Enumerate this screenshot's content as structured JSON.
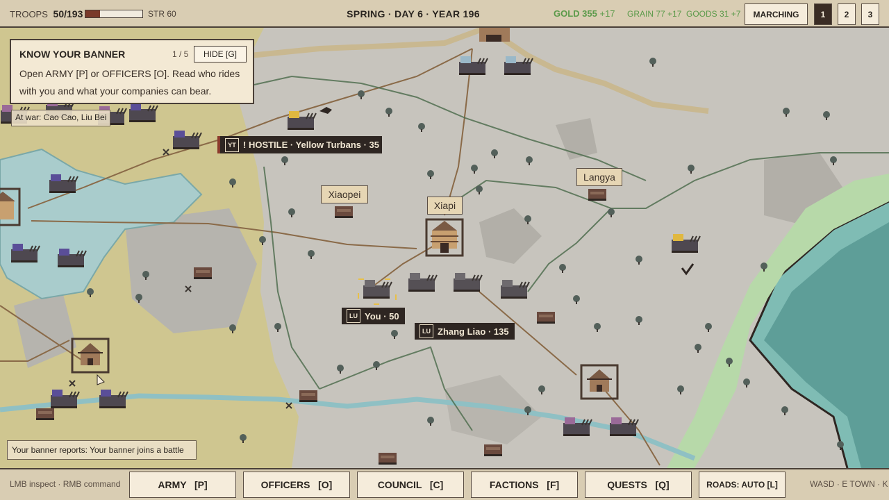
{
  "topbar": {
    "troops_label": "TROOPS",
    "troops_value": "50/193",
    "troops_fraction": 0.26,
    "strength": "STR 60",
    "date": "SPRING · DAY 6 · YEAR 196",
    "gold": "GOLD 355",
    "gold_delta": "+17",
    "grain": "GRAIN 77",
    "grain_delta": "+17",
    "goods": "GOODS 31",
    "goods_delta": "+7",
    "mode_button": "MARCHING",
    "speeds": [
      "1",
      "2",
      "3"
    ],
    "active_speed": "1"
  },
  "tutorial": {
    "title": "KNOW YOUR BANNER",
    "page": "1 / 5",
    "hide_button": "HIDE [G]",
    "body": "Open ARMY [P] or OFFICERS [O]. Read who rides with you and what your companies can bear."
  },
  "map": {
    "war_status": "At war: Cao Cao, Liu Bei",
    "hostile_badge": "YT",
    "hostile_label": "! HOSTILE · Yellow Turbans · 35",
    "player_badge": "LU",
    "player_label": "You · 50",
    "ally_badge": "LU",
    "ally_label": "Zhang Liao · 135",
    "towns": [
      "Xiaopei",
      "Xiapi",
      "Langya"
    ],
    "report": "Your banner reports: Your banner joins a battle"
  },
  "bottombar": {
    "hint_left": "LMB inspect  ·  RMB command",
    "buttons": [
      "ARMY   [P]",
      "OFFICERS   [O]",
      "COUNCIL   [C]",
      "FACTIONS   [F]",
      "QUESTS   [Q]"
    ],
    "roads_button": "ROADS: AUTO [L]",
    "hint_right": "WASD · E TOWN · K"
  },
  "colors": {
    "parchment": "#d9cdb3",
    "grassland": "#cfc690",
    "plains": "#c7c4bd",
    "water": "#a9cccc",
    "coast": "#7fbcb4",
    "road": "#8a6a48",
    "positive": "#5b9a4a",
    "hostile": "#8a3a2c"
  }
}
